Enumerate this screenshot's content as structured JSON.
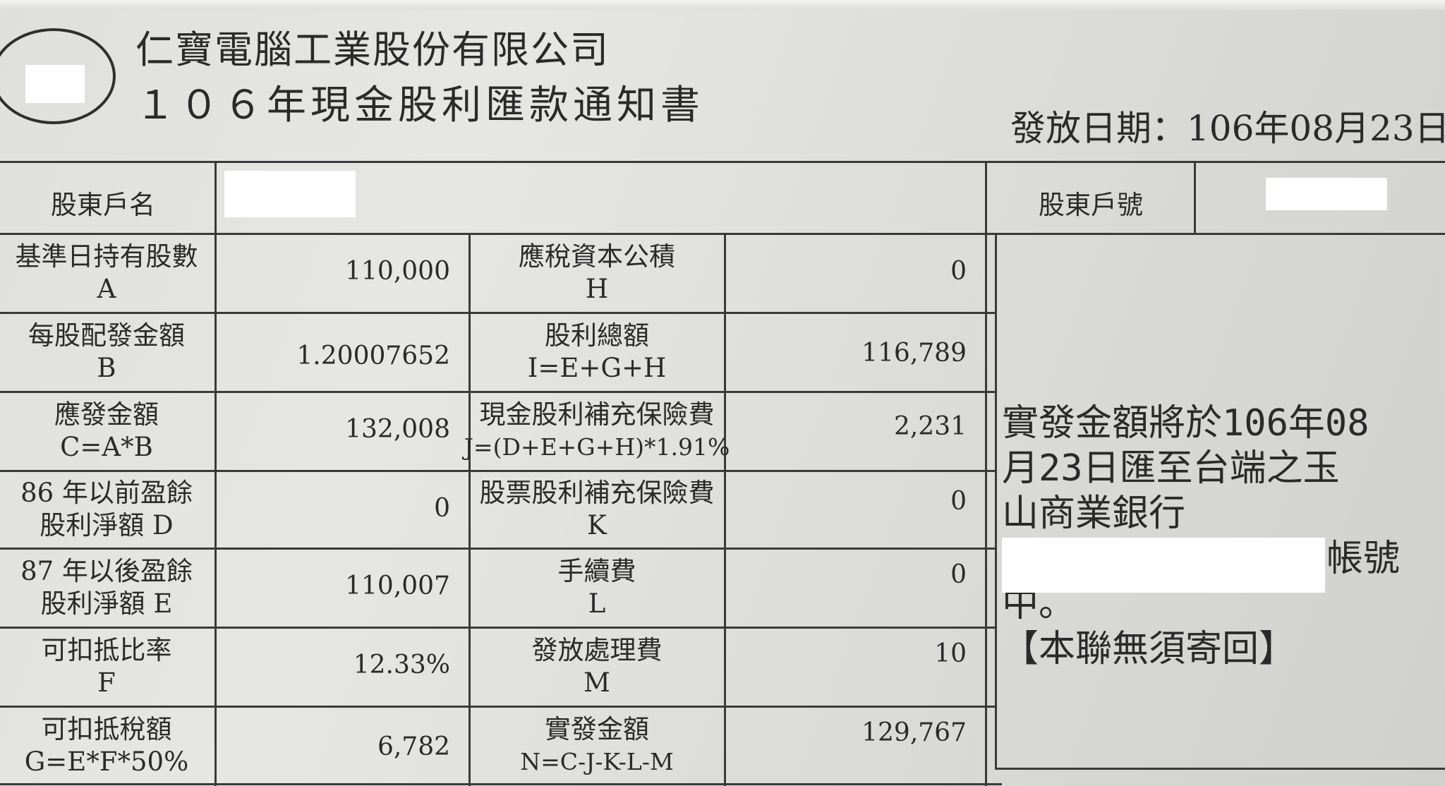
{
  "header": {
    "company": "仁寶電腦工業股份有限公司",
    "title": "１０６年現金股利匯款通知書",
    "issue_date": "發放日期：106年08月23日"
  },
  "account": {
    "name_label": "股東戶名",
    "number_label": "股東戶號"
  },
  "left_rows": [
    {
      "label": "基準日持有股數",
      "code": "A",
      "value": "110,000"
    },
    {
      "label": "每股配發金額",
      "code": "B",
      "value": "1.20007652"
    },
    {
      "label": "應發金額",
      "code": "C=A*B",
      "value": "132,008"
    },
    {
      "label": "86 年以前盈餘",
      "code": "股利淨額 D",
      "value": "0"
    },
    {
      "label": "87 年以後盈餘",
      "code": "股利淨額 E",
      "value": "110,007"
    },
    {
      "label": "可扣抵比率",
      "code": "F",
      "value": "12.33%"
    },
    {
      "label": "可扣抵稅額",
      "code": "G=E*F*50%",
      "value": "6,782"
    }
  ],
  "right_rows": [
    {
      "label": "應稅資本公積",
      "code": "H",
      "value": "0"
    },
    {
      "label": "股利總額",
      "code": "I=E+G+H",
      "value": "116,789"
    },
    {
      "label": "現金股利補充保險費",
      "code": "J=(D+E+G+H)*1.91%",
      "value": "2,231"
    },
    {
      "label": "股票股利補充保險費",
      "code": "K",
      "value": "0"
    },
    {
      "label": "手續費",
      "code": "L",
      "value": "0"
    },
    {
      "label": "發放處理費",
      "code": "M",
      "value": "10"
    },
    {
      "label": "實發金額",
      "code": "N=C-J-K-L-M",
      "value": "129,767"
    }
  ],
  "note": {
    "line1": "實發金額將於106年08",
    "line2": "月23日匯至台端之玉",
    "line3": "山商業銀行",
    "line4": "帳號",
    "line5": "中。",
    "line6": "【本聯無須寄回】"
  }
}
